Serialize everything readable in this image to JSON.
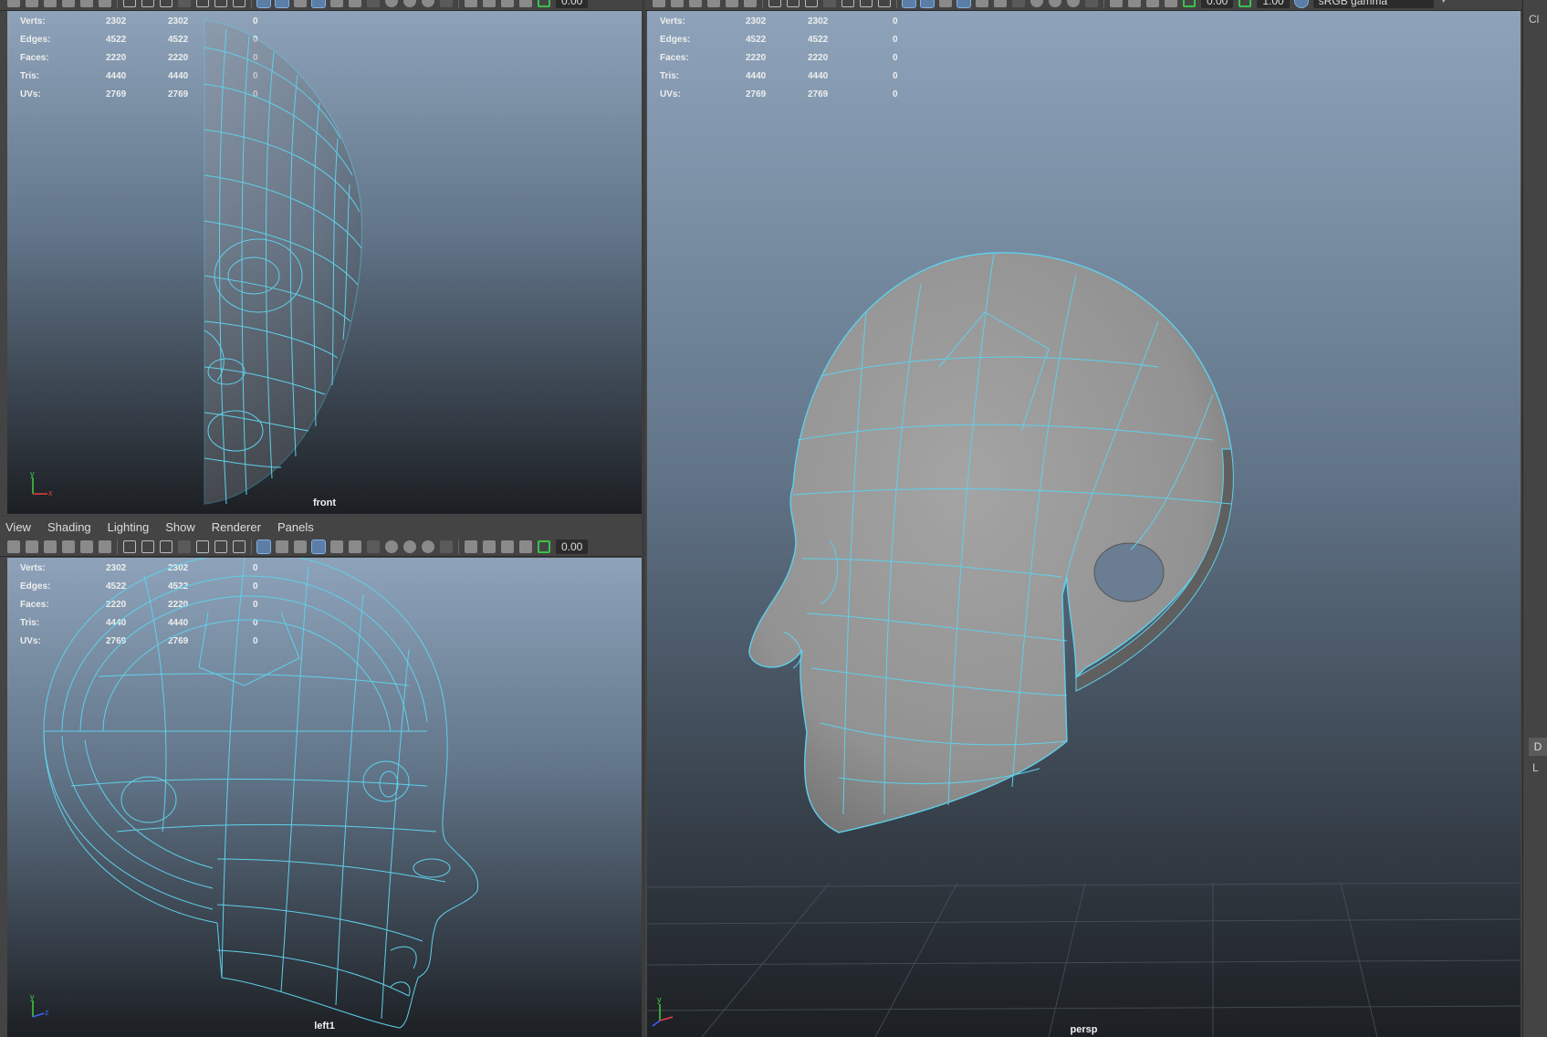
{
  "hud_stats": [
    {
      "label": "Verts:",
      "v1": "2302",
      "v2": "2302",
      "v3": "0"
    },
    {
      "label": "Edges:",
      "v1": "4522",
      "v2": "4522",
      "v3": "0"
    },
    {
      "label": "Faces:",
      "v1": "2220",
      "v2": "2220",
      "v3": "0"
    },
    {
      "label": "Tris:",
      "v1": "4440",
      "v2": "4440",
      "v3": "0"
    },
    {
      "label": "UVs:",
      "v1": "2769",
      "v2": "2769",
      "v3": "0"
    }
  ],
  "panel_menu": [
    "View",
    "Shading",
    "Lighting",
    "Show",
    "Renderer",
    "Panels"
  ],
  "viewports": {
    "front": {
      "camera": "front"
    },
    "left": {
      "camera": "left1"
    },
    "persp": {
      "camera": "persp"
    }
  },
  "toolbar": {
    "exposure": "0.00",
    "gamma": "1.00",
    "color_space": "sRGB gamma"
  },
  "sidebar": {
    "top_label": "Cl",
    "dbtn": "D",
    "lbtn": "L"
  },
  "axis": {
    "x": "x",
    "y": "y",
    "z": "z"
  },
  "colors": {
    "wire": "#5fd0ea",
    "mesh": "#9a9a9a",
    "axis_x": "#e04040",
    "axis_y": "#40d040",
    "axis_z": "#4060ff"
  }
}
